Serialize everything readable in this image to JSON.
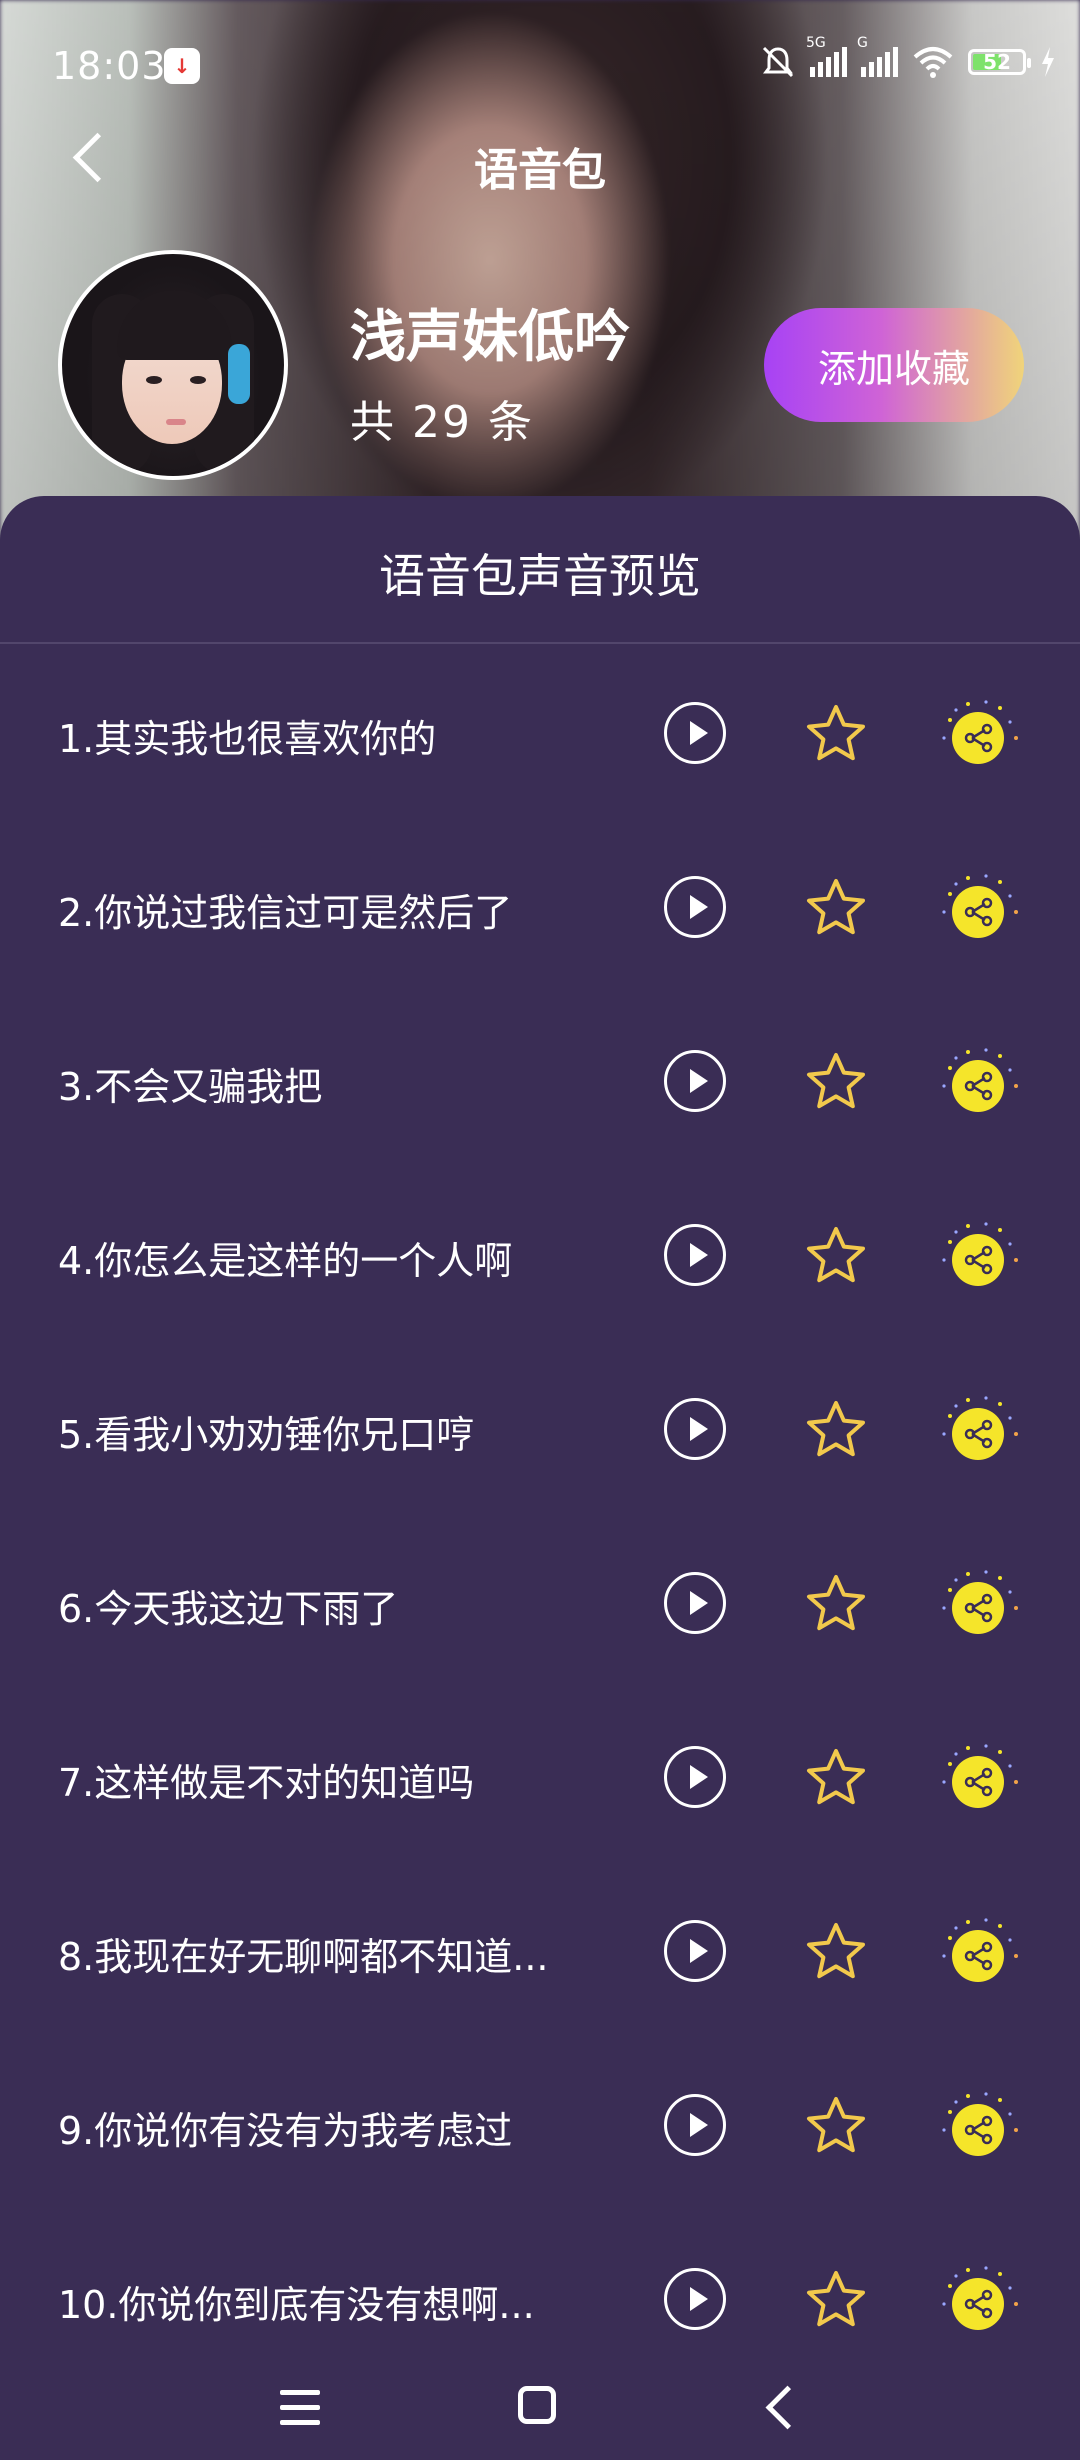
{
  "status_bar": {
    "time": "18:03",
    "signal_1_label": "5G",
    "signal_2_label": "G",
    "battery": "52"
  },
  "header": {
    "title": "语音包"
  },
  "profile": {
    "name": "浅声妹低吟",
    "count": "共 29 条",
    "favorite_label": "添加收藏"
  },
  "panel": {
    "title": "语音包声音预览"
  },
  "items": [
    {
      "label": "1.其实我也很喜欢你的"
    },
    {
      "label": "2.你说过我信过可是然后了"
    },
    {
      "label": "3.不会又骗我把"
    },
    {
      "label": "4.你怎么是这样的一个人啊"
    },
    {
      "label": "5.看我小劝劝锤你兄口哼"
    },
    {
      "label": "6.今天我这边下雨了"
    },
    {
      "label": "7.这样做是不对的知道吗"
    },
    {
      "label": "8.我现在好无聊啊都不知道..."
    },
    {
      "label": "9.你说你有没有为我考虑过"
    },
    {
      "label": "10.你说你到底有没有想啊..."
    }
  ],
  "icons": {
    "play": "play-icon",
    "favorite": "star-icon",
    "share": "share-icon"
  },
  "colors": {
    "panel_bg": "#3a2d55",
    "star": "#f2c94c",
    "share_bg": "#f5e52a",
    "button_gradient_start": "#a742f5",
    "button_gradient_end": "#f0d47a"
  }
}
